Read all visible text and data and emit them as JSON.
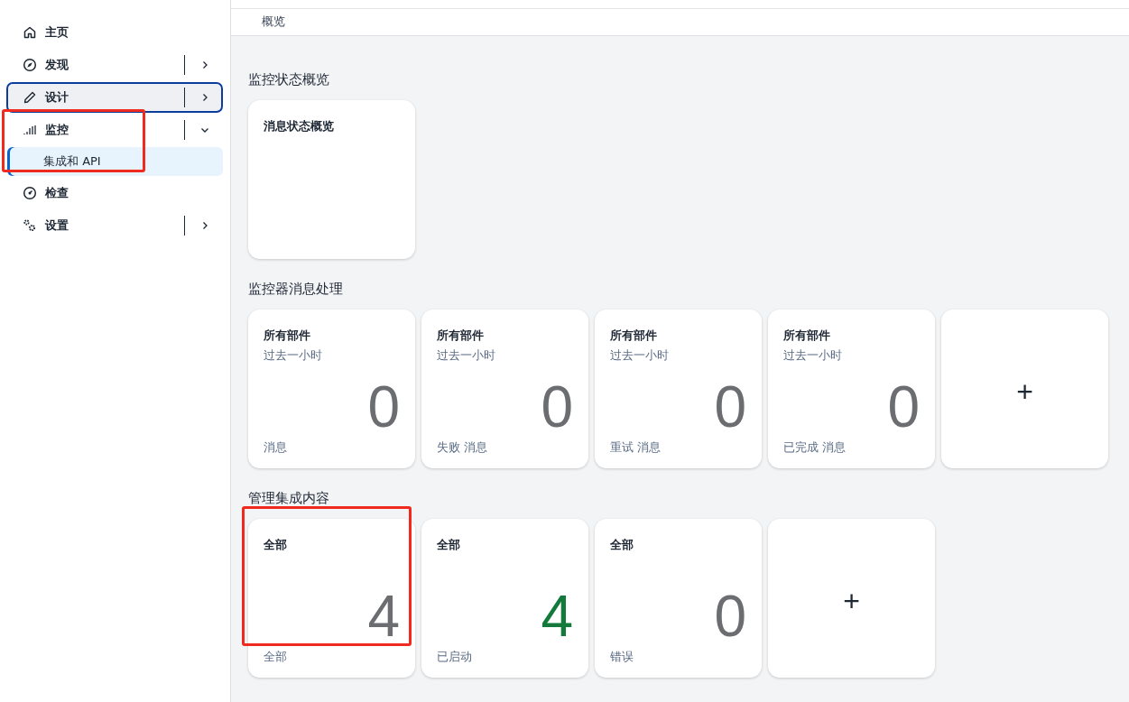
{
  "nav": [
    {
      "label": "主页",
      "selected": false,
      "highlighted": false
    },
    {
      "label": "发现",
      "selected": false,
      "highlighted": false,
      "expanded": false
    },
    {
      "label": "设计",
      "selected": true,
      "highlighted": false,
      "expanded": false
    },
    {
      "label": "监控",
      "selected": false,
      "highlighted": true,
      "expanded": true,
      "children": [
        {
          "label": "集成和 API",
          "selected": true
        }
      ]
    },
    {
      "label": "检查",
      "selected": false,
      "highlighted": false
    },
    {
      "label": "设置",
      "selected": false,
      "highlighted": false,
      "expanded": false
    }
  ],
  "breadcrumb": "概览",
  "sections": [
    {
      "title": "监控状态概览",
      "cards": [
        {
          "kind": "blank",
          "title": "消息状态概览",
          "highlighted": false
        }
      ]
    },
    {
      "title": "监控器消息处理",
      "cards": [
        {
          "kind": "stat",
          "title": "所有部件",
          "subtitle": "过去一小时",
          "value": "0",
          "caption": "消息",
          "color": "#6b6d70",
          "highlighted": false
        },
        {
          "kind": "stat",
          "title": "所有部件",
          "subtitle": "过去一小时",
          "value": "0",
          "caption": "失败 消息",
          "color": "#6b6d70",
          "highlighted": false
        },
        {
          "kind": "stat",
          "title": "所有部件",
          "subtitle": "过去一小时",
          "value": "0",
          "caption": "重试 消息",
          "color": "#6b6d70",
          "highlighted": false
        },
        {
          "kind": "stat",
          "title": "所有部件",
          "subtitle": "过去一小时",
          "value": "0",
          "caption": "已完成 消息",
          "color": "#6b6d70",
          "highlighted": false
        },
        {
          "kind": "add",
          "label": "+",
          "highlighted": false
        }
      ]
    },
    {
      "title": "管理集成内容",
      "cards": [
        {
          "kind": "stat",
          "title": "全部",
          "value": "4",
          "caption": "全部",
          "color": "#6b6d70",
          "highlighted": true
        },
        {
          "kind": "stat",
          "title": "全部",
          "value": "4",
          "caption": "已启动",
          "color": "#137a3c",
          "highlighted": false
        },
        {
          "kind": "stat",
          "title": "全部",
          "value": "0",
          "caption": "错误",
          "color": "#6b6d70",
          "highlighted": false
        },
        {
          "kind": "add",
          "label": "+",
          "highlighted": false
        }
      ]
    }
  ]
}
